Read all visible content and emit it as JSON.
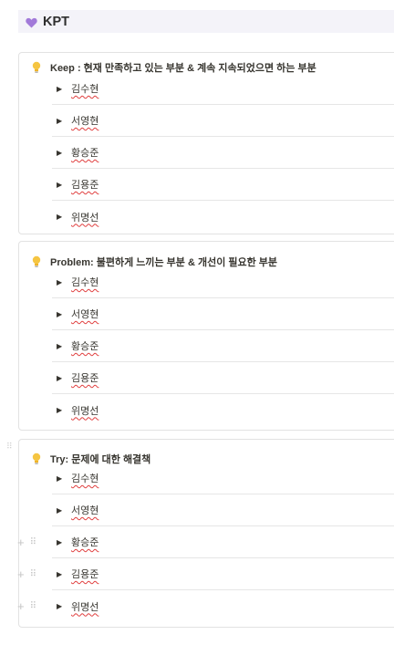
{
  "header": {
    "title": "KPT",
    "icon": "purple-heart-icon",
    "accent": "#9b6bd6"
  },
  "callouts": [
    {
      "icon": "lightbulb-icon",
      "title": "Keep : 현재 만족하고 있는 부분 & 계속 지속되었으면 하는 부분",
      "items": [
        {
          "label": "김수현"
        },
        {
          "label": "서영현"
        },
        {
          "label": "황승준"
        },
        {
          "label": "김용준"
        },
        {
          "label": "위명선"
        }
      ]
    },
    {
      "icon": "lightbulb-icon",
      "title": "Problem: 불편하게 느끼는 부분 & 개선이 필요한 부분",
      "items": [
        {
          "label": "김수현"
        },
        {
          "label": "서영현"
        },
        {
          "label": "황승준"
        },
        {
          "label": "김용준"
        },
        {
          "label": "위명선"
        }
      ]
    },
    {
      "icon": "lightbulb-icon",
      "title": "Try: 문제에 대한 해결책",
      "items": [
        {
          "label": "김수현"
        },
        {
          "label": "서영현"
        },
        {
          "label": "황승준"
        },
        {
          "label": "김용준"
        },
        {
          "label": "위명선"
        }
      ]
    }
  ]
}
